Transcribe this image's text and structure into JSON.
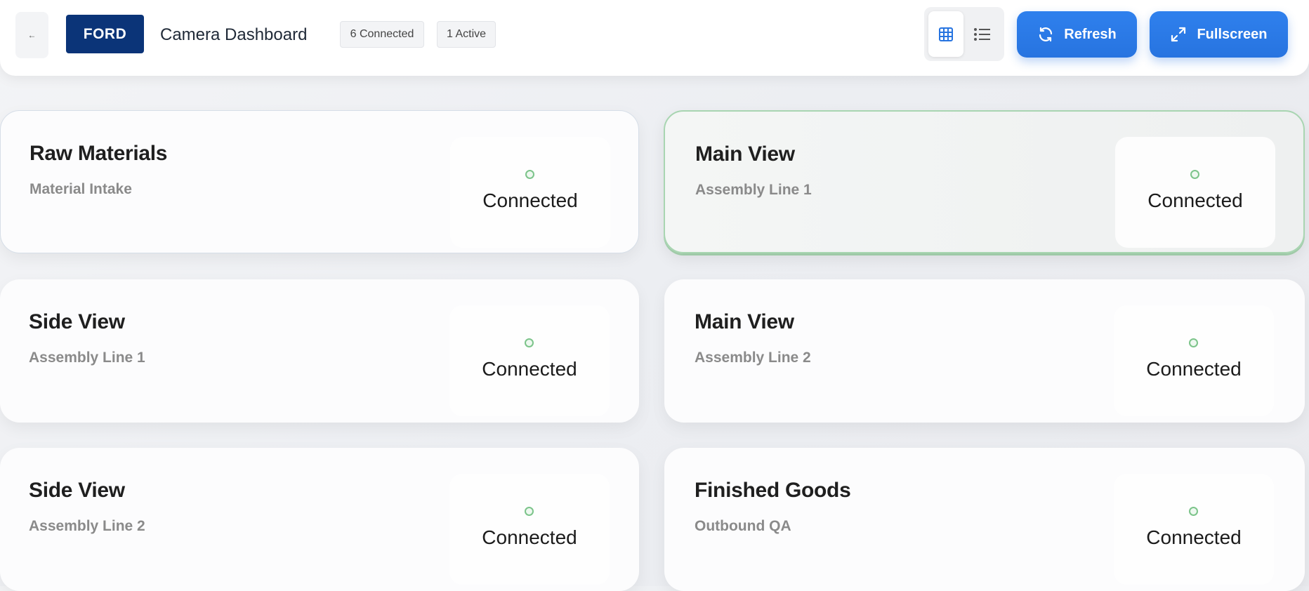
{
  "header": {
    "back_label": "←",
    "brand": "FORD",
    "title": "Camera Dashboard",
    "connected_badge": "6 Connected",
    "active_badge": "1 Active",
    "refresh_label": "Refresh",
    "fullscreen_label": "Fullscreen",
    "view_mode": "grid"
  },
  "colors": {
    "brand": "#0b3478",
    "accent": "#2f80ed",
    "status_ok": "#7cc48a"
  },
  "cameras": [
    {
      "title": "Raw Materials",
      "location": "Material Intake",
      "status": "Connected",
      "active": false
    },
    {
      "title": "Main View",
      "location": "Assembly Line 1",
      "status": "Connected",
      "active": true
    },
    {
      "title": "Side View",
      "location": "Assembly Line 1",
      "status": "Connected",
      "active": false
    },
    {
      "title": "Main View",
      "location": "Assembly Line 2",
      "status": "Connected",
      "active": false
    },
    {
      "title": "Side View",
      "location": "Assembly Line 2",
      "status": "Connected",
      "active": false
    },
    {
      "title": "Finished Goods",
      "location": "Outbound QA",
      "status": "Connected",
      "active": false
    }
  ]
}
